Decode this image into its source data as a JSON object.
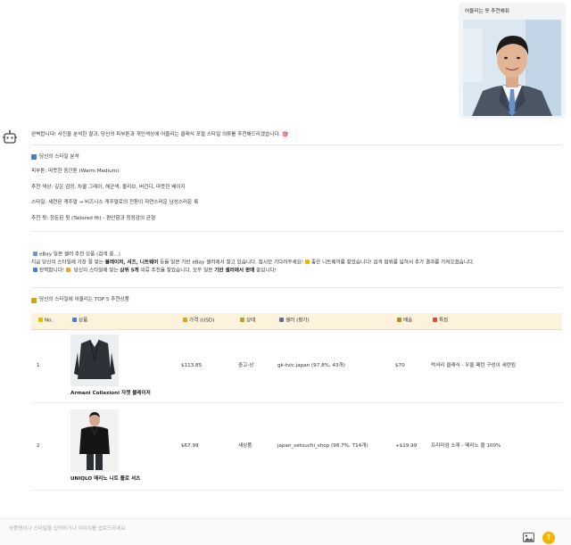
{
  "user_message": {
    "caption": "어울리는 옷 추천해줘"
  },
  "answer": {
    "intro": "완벽합니다! 사진을 분석한 결과, 당신의 피부톤과 개인색상에 어울리는 클래식 포멀 스타일 의류를 추천해드리겠습니다. 🎯",
    "analysis_title": "당신의 스타일 분석",
    "analysis_items": [
      "피부톤: 따뜻한 중간톤 (Warm Medium)",
      "추천 색상: 깊은 검정, 차콜 그레이, 해군색, 올리브, 버건디, 따뜻한 베이지",
      "스타일: 세련된 캐주얼 → 비즈니스 캐주얼로의 전환이 자연스러운 남성스러운 룩",
      "추천 핏: 정돈된 핏 (Tailored fit) - 편안함과 청정감의 균형"
    ],
    "search": {
      "line1": "eBay 일본 셀러 추천 상품 (검색 중...)",
      "line2a": "지금 당신의 스타일에 가장 잘 맞는 ",
      "line2b": "블레이저, 셔츠, 니트웨어",
      "line2c": " 등을 일본 기반 eBay 셀러에서 찾고 있습니다. 잠시만 기다려주세요!",
      "line2d": "좋은 니트웨어를 찾았습니다! 검색 범위를 넓혀서 추가 결과를 가져오겠습니다.",
      "line3a": "완벽합니다!",
      "line3b": " 당신의 스타일에 맞는 ",
      "line3c": "상위 5개",
      "line3d": " 의류 추천을 찾았습니다. 모두 일본 ",
      "line3e": "기반 셀러에서 판매",
      "line3f": " 중입니다!"
    },
    "top5_title": "당신의 스타일에 어울리는 TOP 5 추천상품",
    "table": {
      "headers": [
        "No.",
        "상품",
        "가격 (USD)",
        "상태",
        "셀러 (평가)",
        "배송",
        "특징"
      ],
      "rows": [
        {
          "no": "1",
          "product": "Armani Collezioni 자켓 블레이저",
          "price": "$113.85",
          "condition": "중고-상",
          "seller": "gk-tvic.japan (97.8%, 43개)",
          "shipping": "$70",
          "feature": "럭셔리 클래식 - 우울 패턴 구성이 세련됨"
        },
        {
          "no": "2",
          "product": "UNIQLO 메리노 니트 폴로 셔츠",
          "price": "$67.99",
          "condition": "새상품",
          "seller": "japan_setouchi_shop (98.7%, 714개)",
          "shipping": "+$19.99",
          "feature": "프리미엄 소재 - 메리노 울 100%"
        }
      ]
    }
  },
  "input": {
    "placeholder": "상품명이나 스타일을 입력하거나 이미지를 업로드하세요."
  },
  "icons": [
    "bot-icon",
    "image-upload-icon",
    "send-arrow-icon",
    "clipboard-icon",
    "hourglass-icon",
    "trophy-icon"
  ],
  "colors": {
    "accent_yellow": "#f4b400",
    "table_header_bg": "#fdf3da",
    "section_blue": "#4a7bd0"
  }
}
